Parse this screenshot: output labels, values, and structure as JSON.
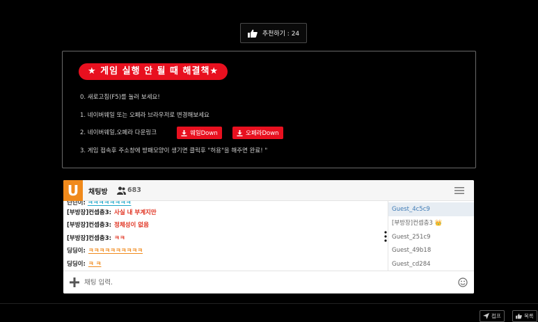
{
  "recommend": {
    "label": "추천하기 : 24"
  },
  "guide": {
    "title": "★ 게임 실행 안 될 때 해결책★",
    "line0": "0. 새로고침(F5)를 눌러 보세요!",
    "line1": "1. 네이버웨일 또는 오페라 브라우저로 변경해보세요",
    "line2": "2. 네이버웨일,오페라 다운링크",
    "whale_down": "웨일Down",
    "opera_down": "오페라Down",
    "line3": "3. 게임 접속후 주소창에 방패모양이 생기면 클릭후 \"허용\"을 해주면 완료! \""
  },
  "chat": {
    "logo": "U",
    "title": "채팅방",
    "user_count": "683",
    "cut_prefix": "딘딘이:",
    "cut_text": "ㅋㅋㅋㅋㅋㅋㅋㅋ",
    "messages": [
      {
        "name": "[부방장]컨셉충3:",
        "text": "사실 내 부계지만"
      },
      {
        "name": "[부방장]컨셉충3:",
        "text": "정체성이 없음"
      },
      {
        "name": "[부방장]컨셉충3:",
        "text": "ㅋㅋ"
      },
      {
        "name": "딩딩이:",
        "text": "ㅋㅋㅋㅋㅋㅋㅋㅋㅋㅋ"
      },
      {
        "name": "딩딩이:",
        "text": "ㅋ ㅋ"
      }
    ],
    "users": [
      "Guest_4c5c9",
      "[부방장]컨셉충3 👑",
      "Guest_251c9",
      "Guest_49b18",
      "Guest_cd284"
    ],
    "input_placeholder": "채팅 입력."
  },
  "footer": {
    "report": "접프",
    "recommend": "목록"
  },
  "colors": {
    "accent_red": "#e8101f",
    "brand_orange": "#f08a1c",
    "link_blue": "#3d7ab5"
  },
  "icons": [
    "thumbs-up-icon",
    "download-icon",
    "users-icon",
    "menu-icon",
    "plus-icon",
    "emoji-icon",
    "send-icon"
  ]
}
